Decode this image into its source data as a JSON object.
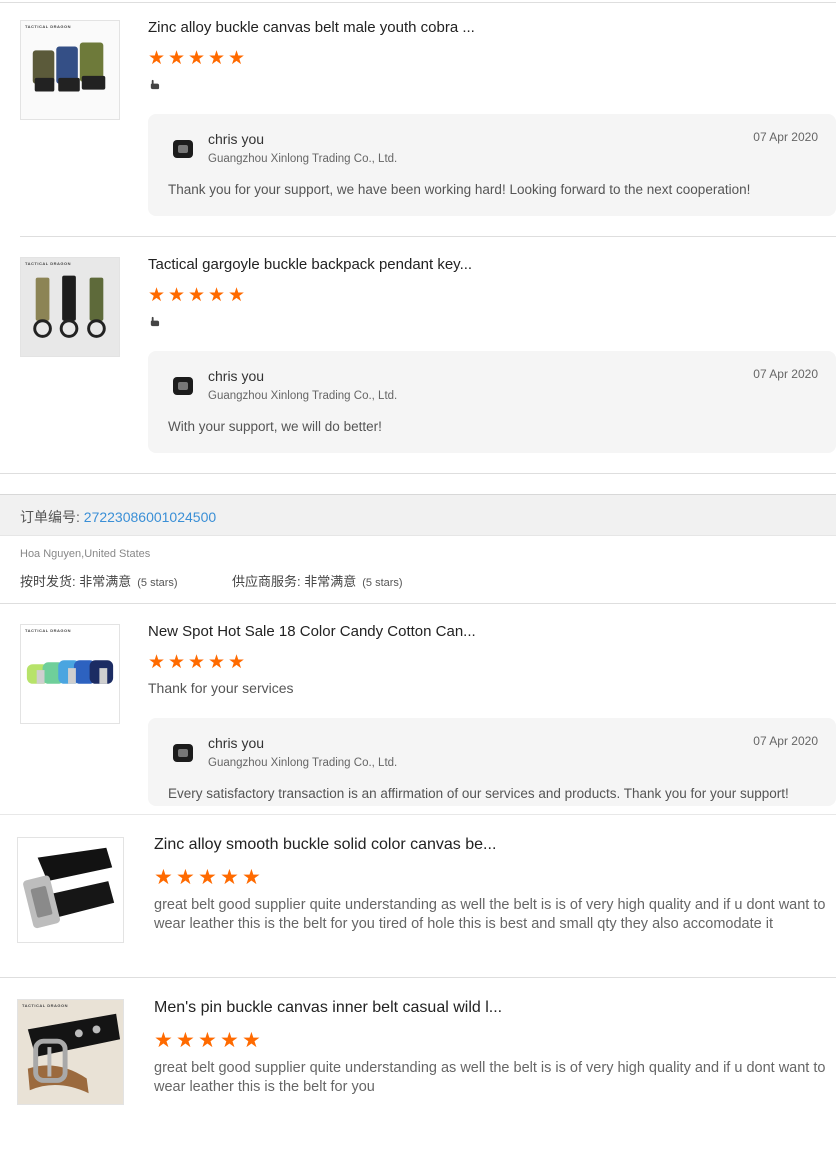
{
  "reviews_top": [
    {
      "title": "Zinc alloy buckle canvas belt male youth cobra ...",
      "stars": 5,
      "thumb_tag": "TACTICAL DRAGON",
      "reply": {
        "name": "chris you",
        "company": "Guangzhou Xinlong Trading Co., Ltd.",
        "date": "07 Apr 2020",
        "text": "Thank you for your support, we have been working hard! Looking forward to the next cooperation!"
      }
    },
    {
      "title": "Tactical gargoyle buckle backpack pendant key...",
      "stars": 5,
      "thumb_tag": "TACTICAL DRAGON",
      "reply": {
        "name": "chris you",
        "company": "Guangzhou Xinlong Trading Co., Ltd.",
        "date": "07 Apr 2020",
        "text": "With your support, we will do better!"
      }
    }
  ],
  "order": {
    "label": "订单编号: ",
    "number": "27223086001024500",
    "buyer": "Hoa Nguyen,United States",
    "shipping_label": "按时发货: 非常满意",
    "shipping_stars": "(5 stars)",
    "service_label": "供应商服务: 非常满意",
    "service_stars": "(5 stars)"
  },
  "reviews_order": [
    {
      "title": "New Spot Hot Sale 18 Color Candy Cotton Can...",
      "stars": 5,
      "thumb_tag": "TACTICAL DRAGON",
      "comment": "Thank for your services",
      "reply": {
        "name": "chris you",
        "company": "Guangzhou Xinlong Trading Co., Ltd.",
        "date": "07 Apr 2020",
        "text": "Every satisfactory transaction is an affirmation of our services and products. Thank you for your support!"
      }
    },
    {
      "title": "Zinc alloy smooth buckle solid color canvas be...",
      "stars": 5,
      "comment_line1": "great belt good supplier quite understanding as well the belt is is of very high quality and if u dont want to",
      "comment_line2": "wear leather this is the belt for you tired of hole this is best and small qty they also accomodate it"
    },
    {
      "title": "Men's pin buckle canvas inner belt casual wild l...",
      "stars": 5,
      "thumb_tag": "TACTICAL DRAGON",
      "comment_line1": "great belt good supplier quite understanding as well the belt is is of very high quality and if u dont want to",
      "comment_line2": "wear leather this is the belt for you"
    }
  ],
  "colors": {
    "star": "#ff6a00",
    "link": "#3a8fd6",
    "reply_bg": "#f5f5f5"
  },
  "icons": {
    "star": "star-icon",
    "hand": "thumb-hand-icon",
    "avatar": "buckle-avatar-icon"
  }
}
